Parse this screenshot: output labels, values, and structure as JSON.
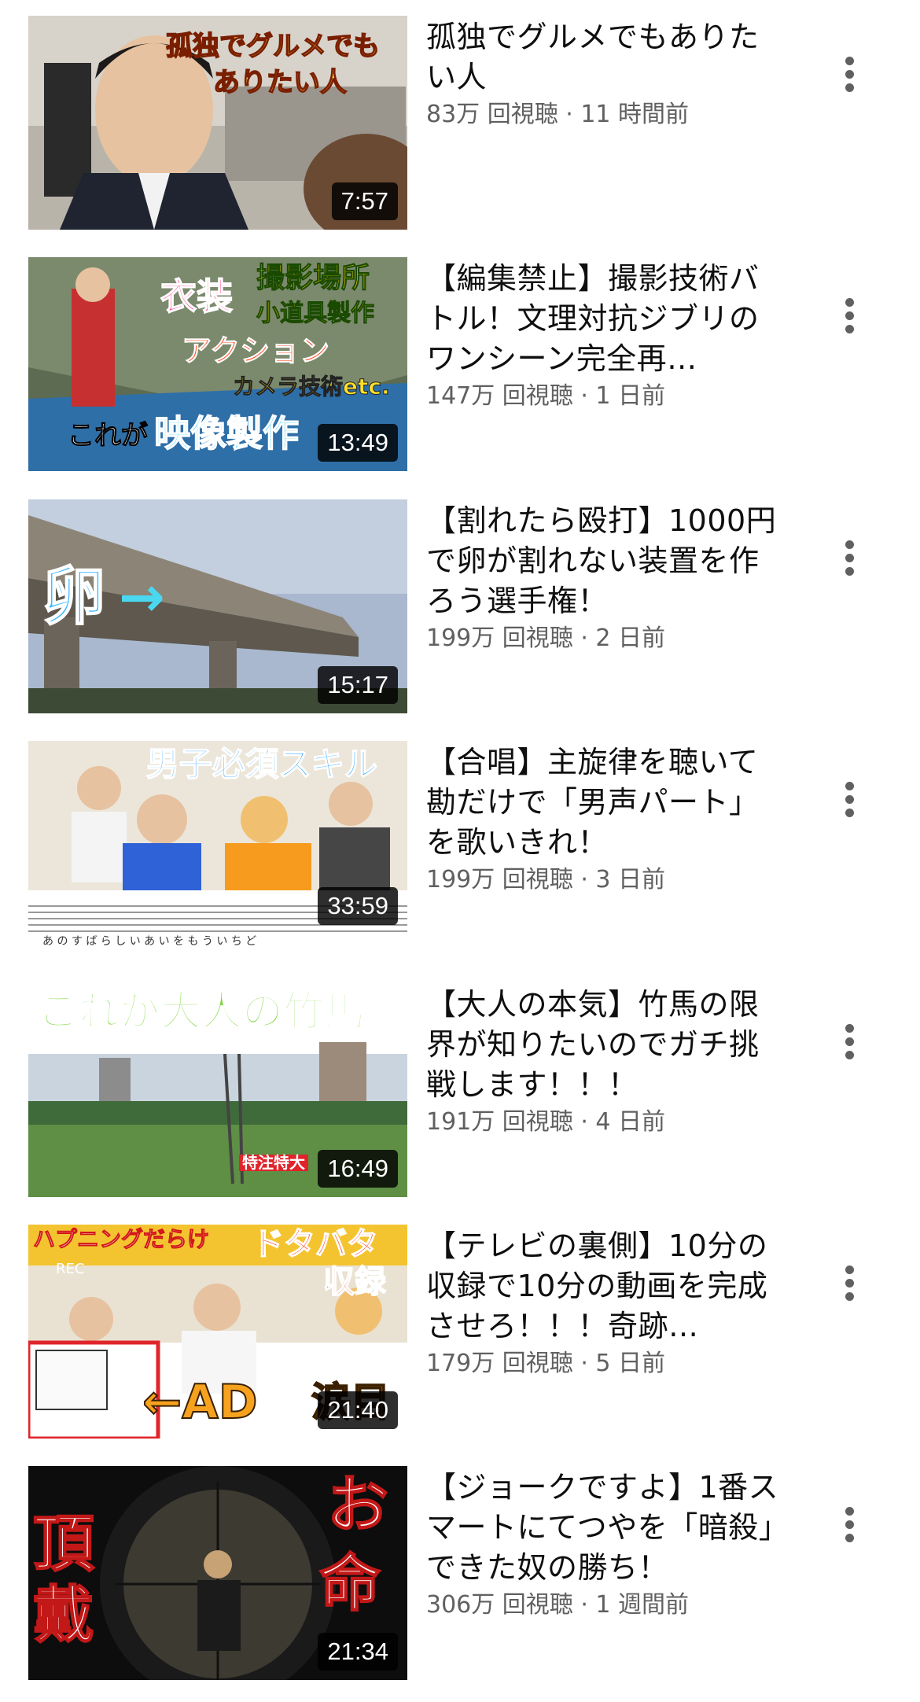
{
  "videos": [
    {
      "title": "孤独でグルメでもありたい人",
      "views": "83万 回視聴",
      "ago": "11 時間前",
      "duration": "7:57",
      "thumb_caption": [
        "孤独でグルメでも",
        "ありたい人"
      ]
    },
    {
      "title": "【編集禁止】撮影技術バトル！文理対抗ジブリのワンシーン完全再…",
      "views": "147万 回視聴",
      "ago": "1 日前",
      "duration": "13:49",
      "thumb_caption": [
        "衣装",
        "撮影場所",
        "小道具製作",
        "アクション",
        "カメラ技術etc.",
        "これが",
        "映像製作"
      ]
    },
    {
      "title": "【割れたら殴打】1000円で卵が割れない装置を作ろう選手権！",
      "views": "199万 回視聴",
      "ago": "2 日前",
      "duration": "15:17",
      "thumb_caption": [
        "卵",
        "→"
      ]
    },
    {
      "title": "【合唱】主旋律を聴いて勘だけで「男声パート」を歌いきれ！",
      "views": "199万 回視聴",
      "ago": "3 日前",
      "duration": "33:59",
      "thumb_caption": [
        "男子必須スキル",
        "あ の す ば ら し い あ い を も う い ち ど"
      ]
    },
    {
      "title": "【大人の本気】竹馬の限界が知りたいのでガチ挑戦します！！！",
      "views": "191万 回視聴",
      "ago": "4 日前",
      "duration": "16:49",
      "thumb_caption": [
        "これが大人の竹馬",
        "特注特大"
      ]
    },
    {
      "title": "【テレビの裏側】10分の収録で10分の動画を完成させろ！！！奇跡…",
      "views": "179万 回視聴",
      "ago": "5 日前",
      "duration": "21:40",
      "thumb_caption": [
        "ハプニングだらけ",
        "ドタバタ",
        "収録",
        "REC",
        "←AD",
        "涙目"
      ]
    },
    {
      "title": "【ジョークですよ】1番スマートにてつやを「暗殺」できた奴の勝ち！",
      "views": "306万 回視聴",
      "ago": "1 週間前",
      "duration": "21:34",
      "thumb_caption": [
        "頂",
        "戴",
        "お",
        "命"
      ]
    }
  ],
  "separator": " · "
}
